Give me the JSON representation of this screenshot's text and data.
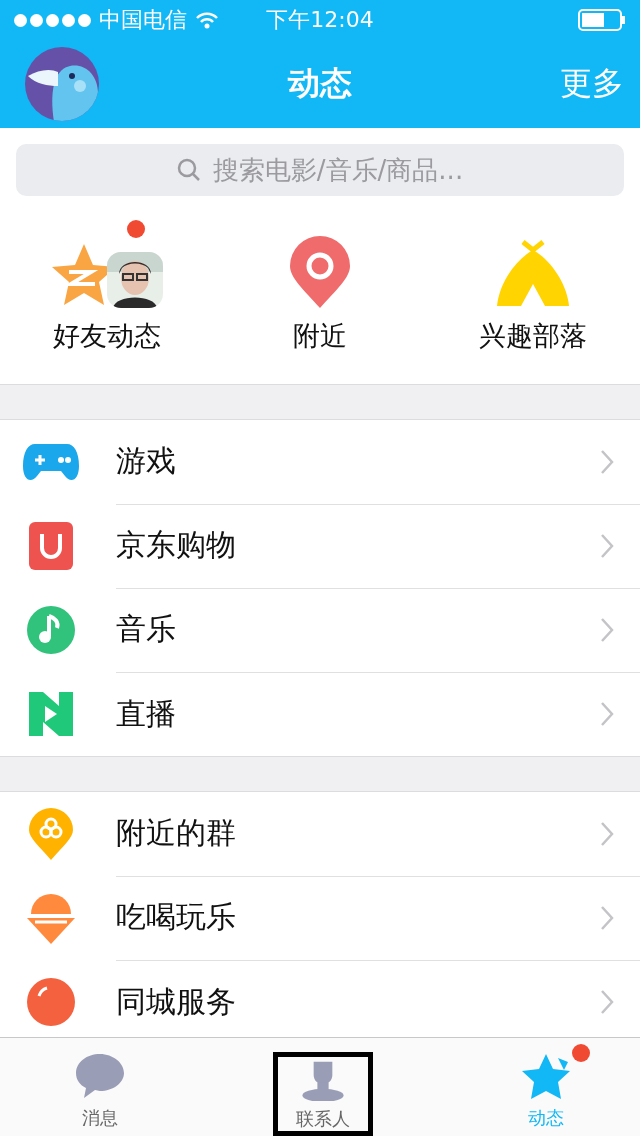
{
  "status_bar": {
    "carrier": "中国电信",
    "time": "下午12:04"
  },
  "nav": {
    "title": "动态",
    "action": "更多"
  },
  "search": {
    "placeholder": "搜索电影/音乐/商品..."
  },
  "quick_items": [
    {
      "kind": "friends",
      "label": "好友动态",
      "badge": true
    },
    {
      "kind": "nearby",
      "label": "附近",
      "badge": false
    },
    {
      "kind": "tribe",
      "label": "兴趣部落",
      "badge": false
    }
  ],
  "sections": [
    [
      {
        "kind": "game",
        "label": "游戏"
      },
      {
        "kind": "shop",
        "label": "京东购物"
      },
      {
        "kind": "music",
        "label": "音乐"
      },
      {
        "kind": "live",
        "label": "直播"
      }
    ],
    [
      {
        "kind": "group",
        "label": "附近的群"
      },
      {
        "kind": "food",
        "label": "吃喝玩乐"
      },
      {
        "kind": "city",
        "label": "同城服务"
      }
    ]
  ],
  "tab_bar": [
    {
      "kind": "messages",
      "label": "消息",
      "selected": false,
      "badge": false,
      "highlighted": false
    },
    {
      "kind": "contacts",
      "label": "联系人",
      "selected": false,
      "badge": false,
      "highlighted": true
    },
    {
      "kind": "feed",
      "label": "动态",
      "selected": true,
      "badge": true,
      "highlighted": false
    }
  ]
}
